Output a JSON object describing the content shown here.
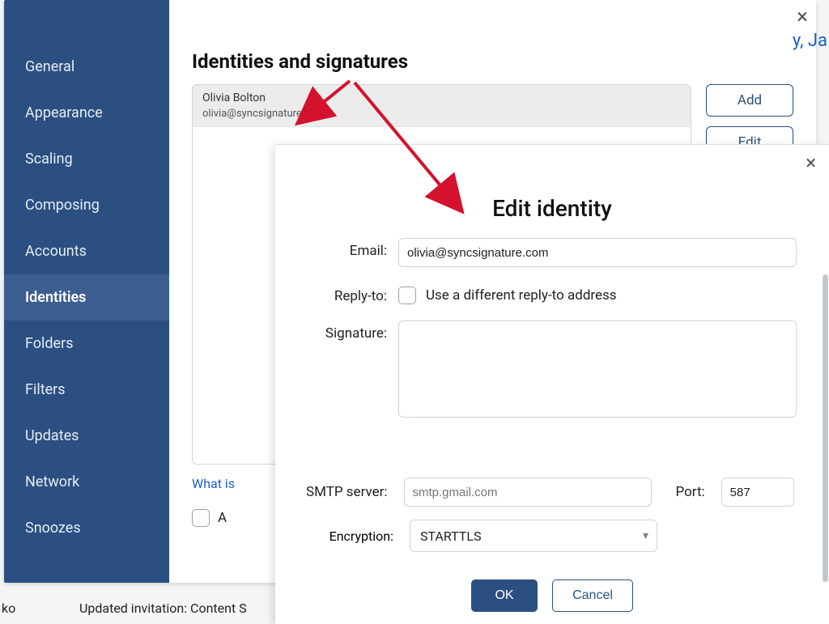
{
  "sidebar": {
    "items": [
      {
        "label": "General"
      },
      {
        "label": "Appearance"
      },
      {
        "label": "Scaling"
      },
      {
        "label": "Composing"
      },
      {
        "label": "Accounts"
      },
      {
        "label": "Identities"
      },
      {
        "label": "Folders"
      },
      {
        "label": "Filters"
      },
      {
        "label": "Updates"
      },
      {
        "label": "Network"
      },
      {
        "label": "Snoozes"
      }
    ]
  },
  "main": {
    "title": "Identities and signatures",
    "identity": {
      "name": "Olivia Bolton",
      "email": "olivia@syncsignature.com"
    },
    "buttons": {
      "add": "Add",
      "edit": "Edit"
    },
    "what_is_link": "What is",
    "always_checkbox_label": "A"
  },
  "modal": {
    "title": "Edit identity",
    "labels": {
      "email": "Email:",
      "reply_to": "Reply-to:",
      "signature": "Signature:",
      "smtp": "SMTP server:",
      "port": "Port:",
      "encryption": "Encryption:"
    },
    "email_value": "olivia@syncsignature.com",
    "reply_checkbox_label": "Use a different reply-to address",
    "smtp_placeholder": "smtp.gmail.com",
    "port_value": "587",
    "encryption_value": "STARTTLS",
    "ok": "OK",
    "cancel": "Cancel"
  },
  "background": {
    "ko": "ko",
    "invitation": "Updated invitation: Content S",
    "right_frag": "y, Ja"
  }
}
